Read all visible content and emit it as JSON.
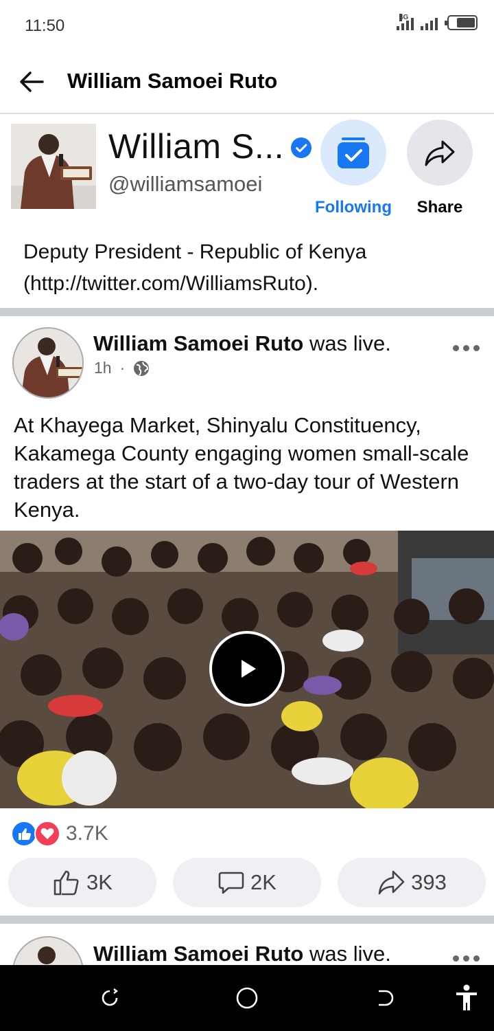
{
  "status_bar": {
    "time": "11:50",
    "network_label": "4G",
    "battery_level": 0.7
  },
  "header": {
    "title": "William Samoei Ruto",
    "back_icon": "back-arrow-icon"
  },
  "profile": {
    "name": "William S...",
    "verified": true,
    "handle": "@williamsamoei",
    "following_label": "Following",
    "share_label": "Share",
    "bio": "Deputy President - Republic of Kenya (http://twitter.com/WilliamsRuto)."
  },
  "posts": [
    {
      "author": "William Samoei Ruto",
      "action": "was live.",
      "time": "1h",
      "privacy_icon": "globe-icon",
      "text": "At Khayega Market, Shinyalu Constituency, Kakamega County engaging women small-scale traders at the start of a two-day tour of Western Kenya.",
      "reaction_count": "3.7K",
      "likes": "3K",
      "comments": "2K",
      "shares": "393"
    },
    {
      "author": "William Samoei Ruto",
      "action": "was live."
    }
  ],
  "colors": {
    "accent": "#1877f2",
    "love": "#f33e58",
    "divider": "#c9ccd1",
    "pill_bg": "#eef0f3"
  }
}
